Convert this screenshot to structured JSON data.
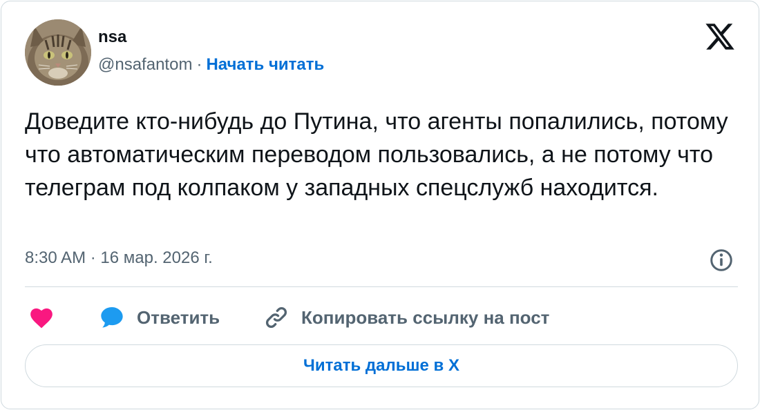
{
  "author": {
    "name": "nsa",
    "handle": "@nsafantom",
    "separator": "·",
    "follow_label": "Начать читать",
    "avatar_icon": "cat-avatar"
  },
  "brand_icon": "x-logo-icon",
  "tweet": {
    "text": "Доведите кто-нибудь до Путина, что агенты попалились, потому что автоматическим переводом пользовались, а не потому что телеграм под колпаком у западных спецслужб находится.",
    "timestamp": "8:30 AM · 16 мар. 2026 г."
  },
  "actions": {
    "like_icon": "heart-icon",
    "reply_icon": "speech-bubble-icon",
    "reply_label": "Ответить",
    "copy_icon": "link-icon",
    "copy_label": "Копировать ссылку на пост"
  },
  "read_more_label": "Читать дальше в X",
  "colors": {
    "accent": "#006fd6",
    "like": "#f91880",
    "reply": "#1d9bf0",
    "muted": "#536471",
    "border": "#cfd9de",
    "text": "#0f1419"
  }
}
